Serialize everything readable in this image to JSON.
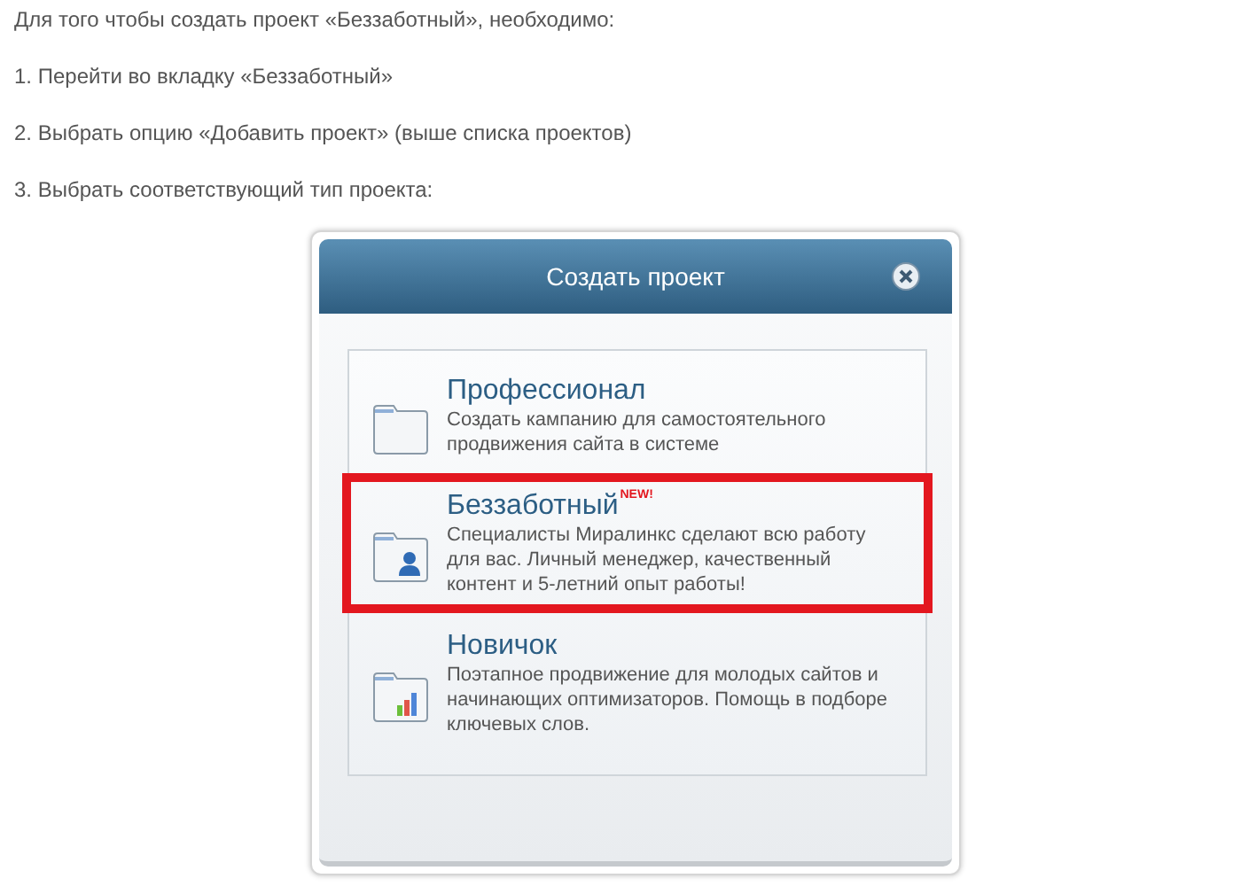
{
  "intro": "Для того чтобы создать проект «Беззаботный», необходимо:",
  "steps": [
    "1. Перейти во вкладку «Беззаботный»",
    "2. Выбрать опцию «Добавить проект» (выше списка проектов)",
    "3. Выбрать соответствующий тип проекта:"
  ],
  "dialog": {
    "title": "Создать проект",
    "close": true,
    "options": [
      {
        "kind": "folder",
        "title": "Профессионал",
        "description": "Создать кампанию для самостоятельного продвижения сайта в системе",
        "selected": false
      },
      {
        "kind": "person",
        "title": "Беззаботный",
        "badge": "NEW!",
        "description": "Специалисты Миралинкс сделают всю работу для вас. Личный менеджер, качественный контент и 5-летний опыт работы!",
        "selected": true
      },
      {
        "kind": "chart",
        "title": "Новичок",
        "description": "Поэтапное продвижение для молодых сайтов и начинающих оптимизаторов. Помощь в подборе ключевых слов.",
        "selected": false
      }
    ]
  }
}
